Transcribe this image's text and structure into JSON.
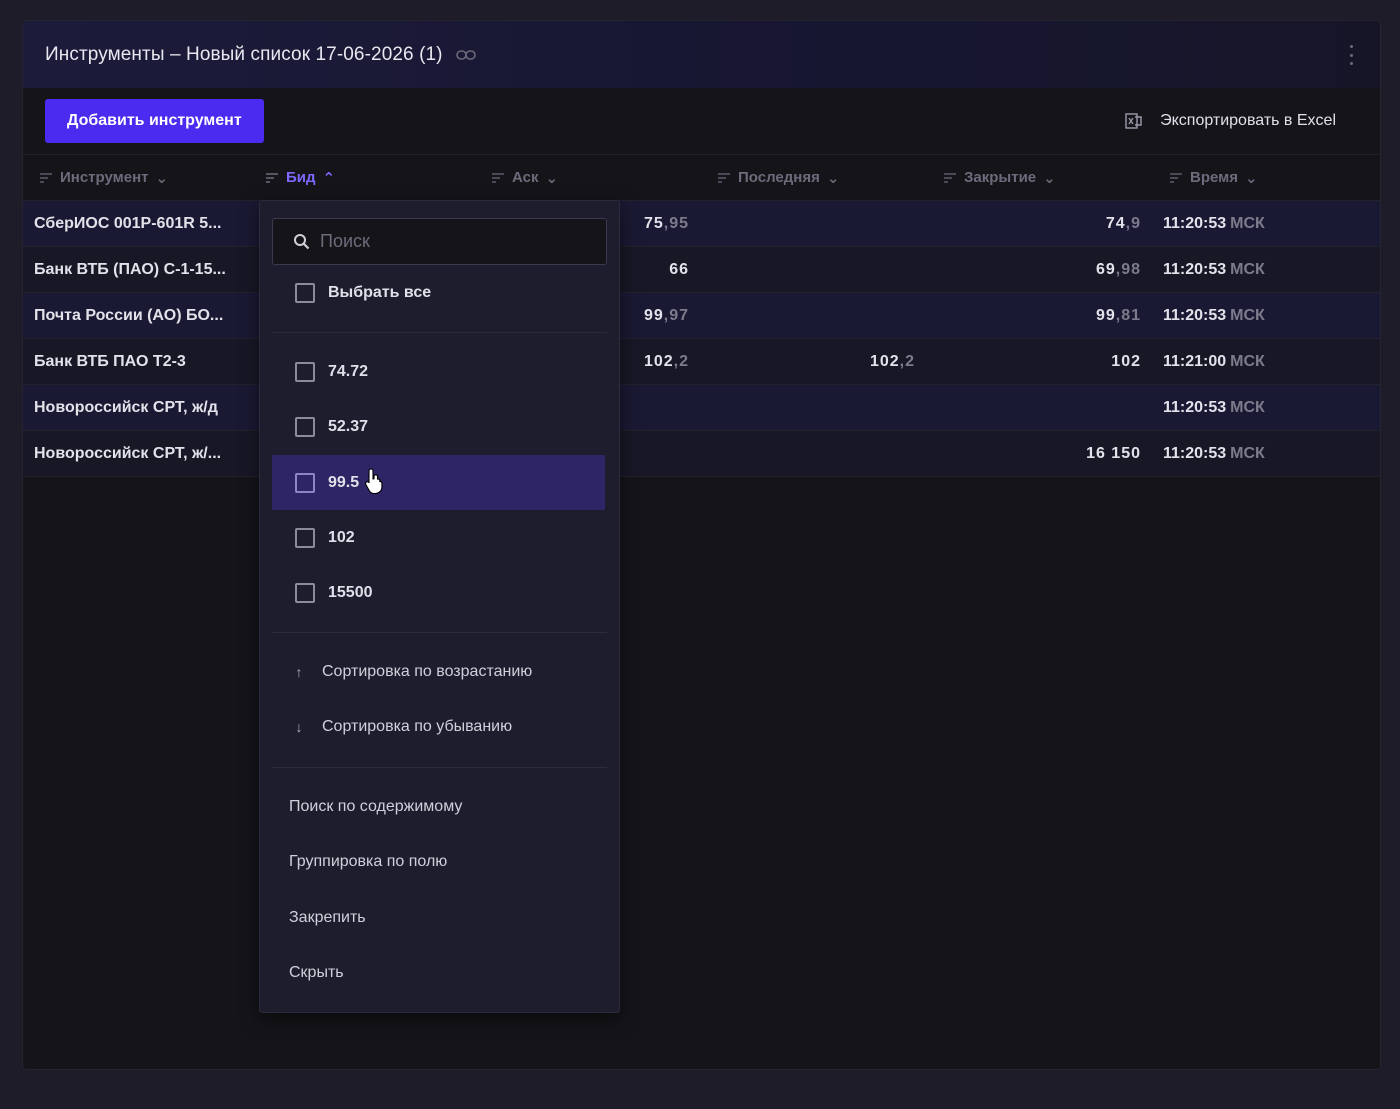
{
  "header": {
    "title": "Инструменты – Новый список 17-06-2026 (1)"
  },
  "toolbar": {
    "add_label": "Добавить инструмент",
    "export_label": "Экспортировать в Excel"
  },
  "columns": [
    "Инструмент",
    "Бид",
    "Аск",
    "Последняя",
    "Закрытие",
    "Время"
  ],
  "rows": [
    {
      "instrument": "СберИОС 001P-601R 5...",
      "ask_int": "75",
      "ask_dec": ",95",
      "last_int": "",
      "last_dec": "",
      "close_int": "74",
      "close_dec": ",9",
      "time": "11:20:53",
      "tz": "МСК"
    },
    {
      "instrument": "Банк ВТБ (ПАО) С-1-15...",
      "ask_int": "66",
      "ask_dec": "",
      "last_int": "",
      "last_dec": "",
      "close_int": "69",
      "close_dec": ",98",
      "time": "11:20:53",
      "tz": "МСК"
    },
    {
      "instrument": "Почта России (АО) БО...",
      "ask_int": "99",
      "ask_dec": ",97",
      "last_int": "",
      "last_dec": "",
      "close_int": "99",
      "close_dec": ",81",
      "time": "11:20:53",
      "tz": "МСК"
    },
    {
      "instrument": "Банк ВТБ ПАО Т2-3",
      "ask_int": "102",
      "ask_dec": ",2",
      "last_int": "102",
      "last_dec": ",2",
      "close_int": "102",
      "close_dec": "",
      "time": "11:21:00",
      "tz": "МСК"
    },
    {
      "instrument": "Новороссийск СРТ, ж/д",
      "ask_int": "",
      "ask_dec": "",
      "last_int": "",
      "last_dec": "",
      "close_int": "",
      "close_dec": "",
      "time": "11:20:53",
      "tz": "МСК"
    },
    {
      "instrument": "Новороссийск СРТ, ж/...",
      "ask_int": "",
      "ask_dec": "",
      "last_int": "",
      "last_dec": "",
      "close_int": "16 150",
      "close_dec": "",
      "time": "11:20:53",
      "tz": "МСК"
    }
  ],
  "filter_menu": {
    "search_placeholder": "Поиск",
    "select_all": "Выбрать все",
    "options": [
      "74.72",
      "52.37",
      "99.5",
      "102",
      "15500"
    ],
    "highlighted_option": "99.5",
    "sort_asc": "Сортировка по возрастанию",
    "sort_desc": "Сортировка по убыванию",
    "content_search": "Поиск по содержимому",
    "group_by": "Группировка по полю",
    "pin": "Закрепить",
    "hide": "Скрыть"
  },
  "colors": {
    "accent": "#4b2bf0",
    "active_header": "#7b68ff",
    "highlight": "#2d2565"
  }
}
